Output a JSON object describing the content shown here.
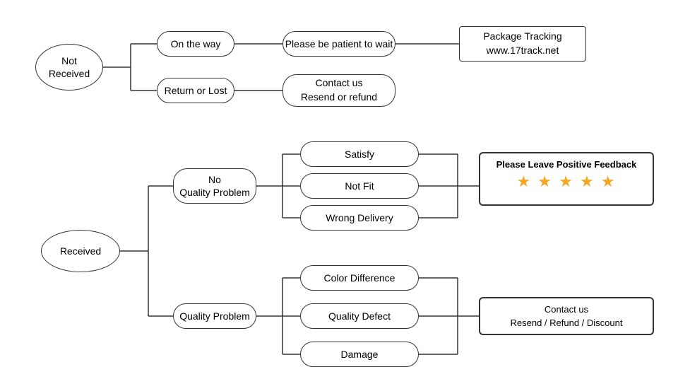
{
  "nodes": {
    "not_received": {
      "label": "Not\nReceived"
    },
    "on_the_way": {
      "label": "On the way"
    },
    "return_or_lost": {
      "label": "Return or Lost"
    },
    "please_patient": {
      "label": "Please be patient to wait"
    },
    "package_tracking": {
      "label": "Package Tracking\nwww.17track.net"
    },
    "contact_resend_refund": {
      "label": "Contact us\nResend or refund"
    },
    "received": {
      "label": "Received"
    },
    "no_quality_problem": {
      "label": "No\nQuality Problem"
    },
    "quality_problem": {
      "label": "Quality Problem"
    },
    "satisfy": {
      "label": "Satisfy"
    },
    "not_fit": {
      "label": "Not Fit"
    },
    "wrong_delivery": {
      "label": "Wrong Delivery"
    },
    "color_difference": {
      "label": "Color Difference"
    },
    "quality_defect": {
      "label": "Quality Defect"
    },
    "damage": {
      "label": "Damage"
    },
    "please_leave_feedback": {
      "label": "Please Leave Positive Feedback"
    },
    "stars": {
      "label": "★ ★ ★ ★ ★"
    },
    "contact_resend_refund_discount": {
      "label": "Contact us\nResend / Refund / Discount"
    }
  }
}
